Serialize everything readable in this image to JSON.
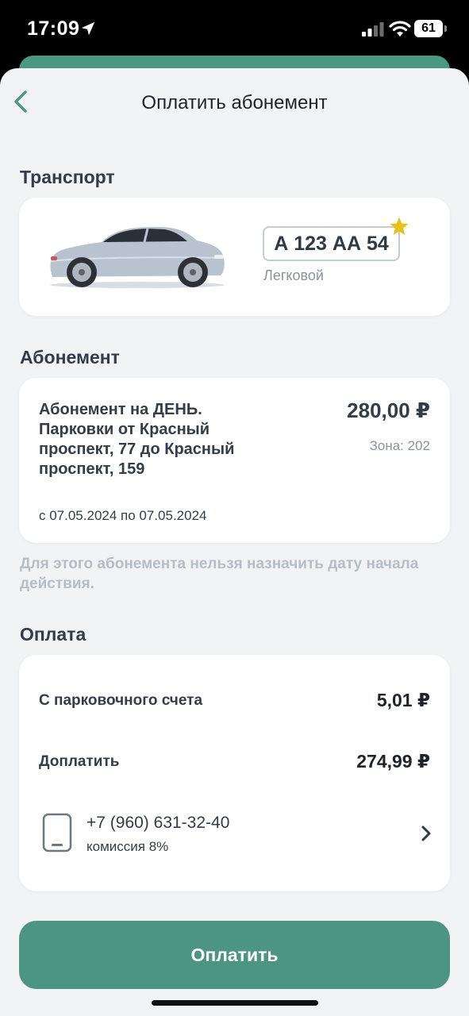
{
  "status_bar": {
    "time": "17:09",
    "battery": "61",
    "icons": [
      "location-arrow-icon",
      "signal-icon",
      "wifi-icon",
      "battery-icon"
    ]
  },
  "header": {
    "title": "Оплатить абонемент",
    "back_icon": "chevron-left-icon"
  },
  "transport": {
    "section_title": "Транспорт",
    "plate": "А 123 АА 54",
    "vehicle_type": "Легковой",
    "favorite_icon": "star-icon",
    "car_icon": "car-image"
  },
  "subscription": {
    "section_title": "Абонемент",
    "description": "Абонемент на ДЕНЬ. Парковки от Красный проспект, 77 до Красный проспект, 159",
    "price": "280,00 ₽",
    "zone": "Зона: 202",
    "dates": "с 07.05.2024 по 07.05.2024",
    "note": "Для этого абонемента нельзя назначить дату начала действия."
  },
  "payment": {
    "section_title": "Оплата",
    "from_account_label": "С парковочного счета",
    "from_account_value": "5,01 ₽",
    "extra_label": "Доплатить",
    "extra_value": "274,99 ₽",
    "phone": "+7 (960) 631-32-40",
    "commission": "комиссия 8%",
    "phone_icon": "phone-icon",
    "chevron_icon": "chevron-right-icon"
  },
  "actions": {
    "pay_label": "Оплатить"
  },
  "colors": {
    "accent": "#4c9582",
    "star": "#e6c21a",
    "background": "#f2f3f5"
  }
}
